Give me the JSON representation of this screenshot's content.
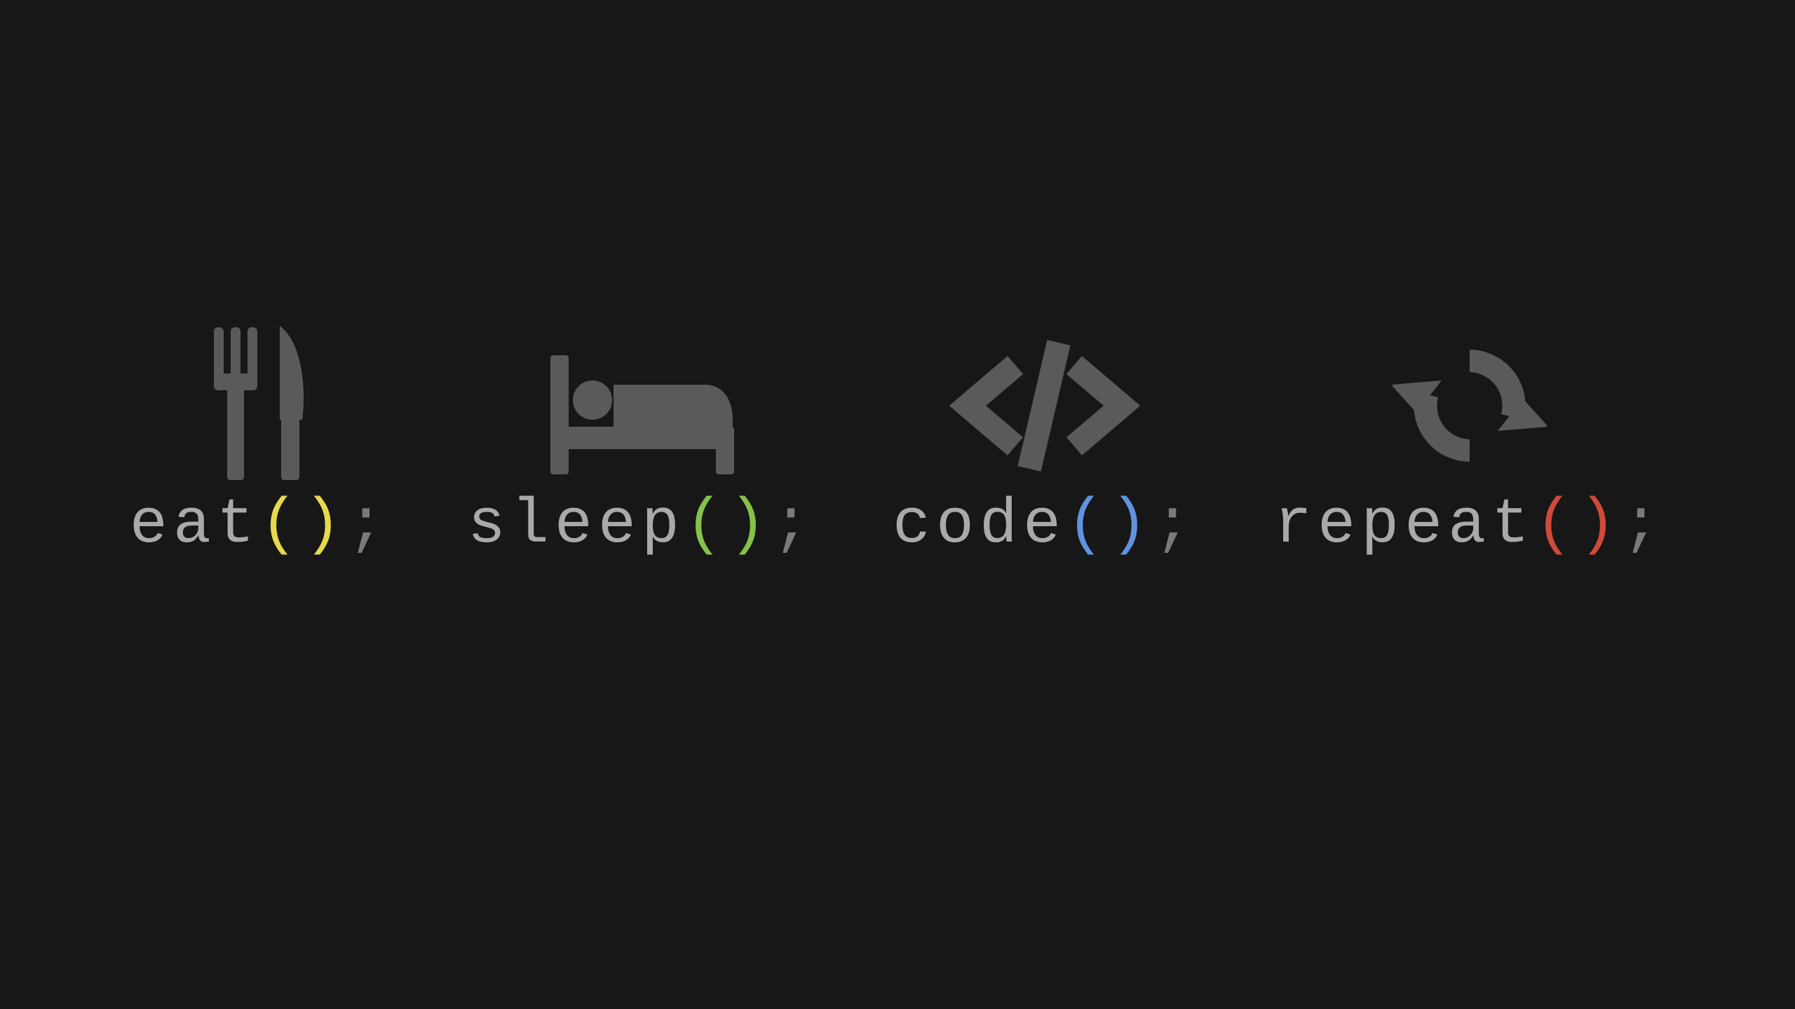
{
  "items": [
    {
      "fn": "eat",
      "open": "(",
      "close": ")",
      "semi": ";",
      "paren_color": "yellow"
    },
    {
      "fn": "sleep",
      "open": "(",
      "close": ")",
      "semi": ";",
      "paren_color": "green"
    },
    {
      "fn": "code",
      "open": "(",
      "close": ")",
      "semi": ";",
      "paren_color": "blue"
    },
    {
      "fn": "repeat",
      "open": "(",
      "close": ")",
      "semi": ";",
      "paren_color": "red"
    }
  ],
  "colors": {
    "yellow": "#e6d94c",
    "green": "#86c14a",
    "blue": "#5f93e0",
    "red": "#cf4a3a"
  }
}
